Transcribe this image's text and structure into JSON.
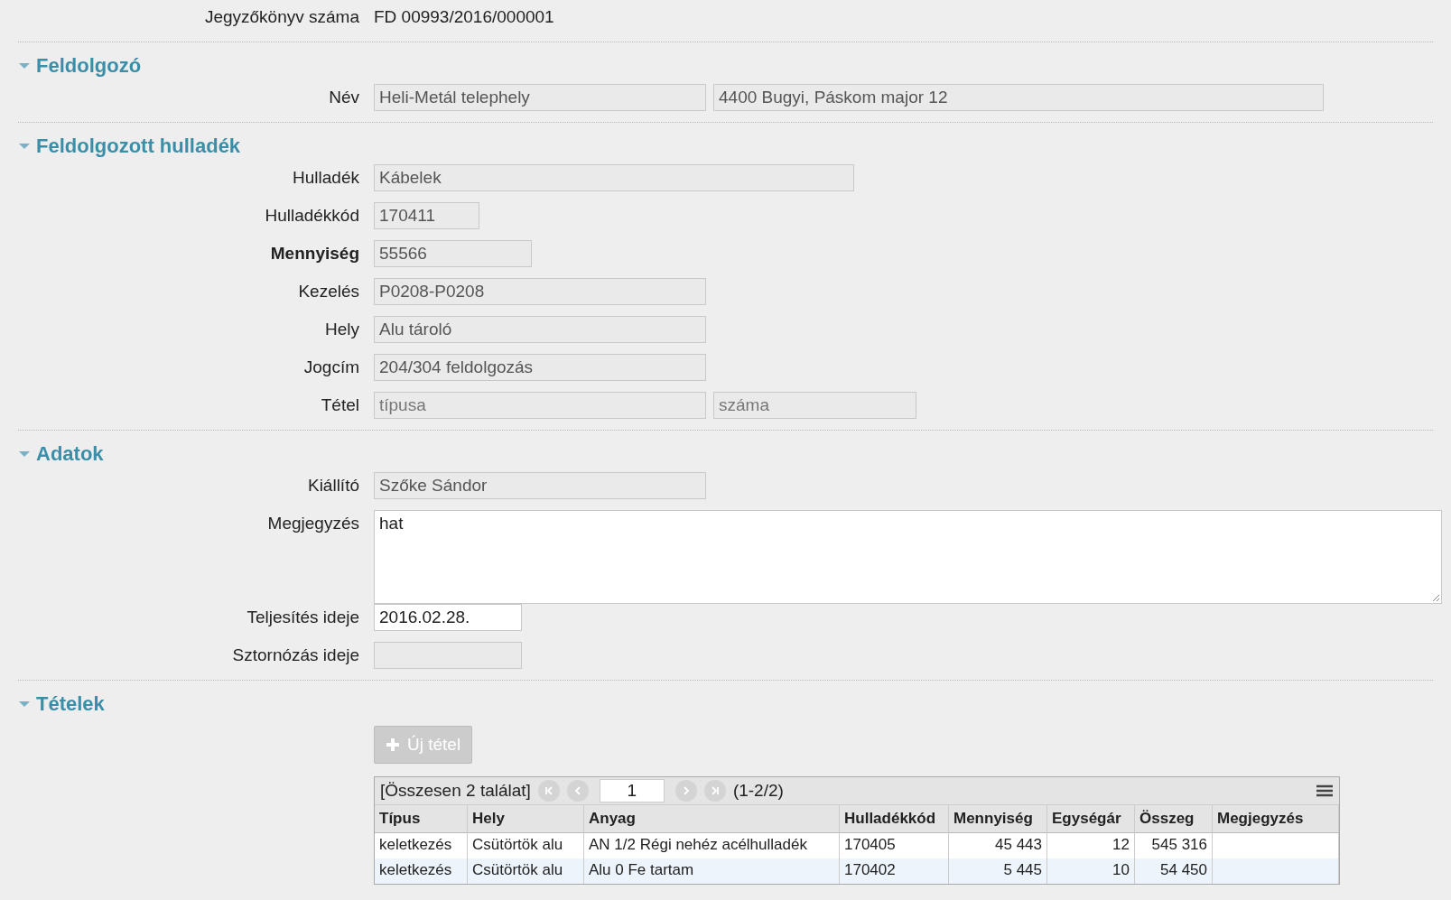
{
  "record": {
    "label": "Jegyzőkönyv száma",
    "value": "FD 00993/2016/000001"
  },
  "sections": [
    {
      "title": "Feldolgozó",
      "expanded": true,
      "rows": [
        {
          "label": "Név",
          "required": false,
          "fields": [
            {
              "kind": "medium",
              "value": "Heli-Metál telephely",
              "editable": false
            },
            {
              "kind": "wide",
              "value": "4400 Bugyi, Páskom major 12",
              "editable": false
            }
          ]
        }
      ]
    },
    {
      "title": "Feldolgozott hulladék",
      "expanded": true,
      "rows": [
        {
          "label": "Hulladék",
          "required": false,
          "fields": [
            {
              "kind": "large",
              "value": "Kábelek",
              "editable": false
            }
          ]
        },
        {
          "label": "Hulladékkód",
          "required": false,
          "fields": [
            {
              "kind": "code",
              "value": "170411",
              "editable": false
            }
          ]
        },
        {
          "label": "Mennyiség",
          "required": true,
          "fields": [
            {
              "kind": "short",
              "value": "55566",
              "editable": false
            }
          ]
        },
        {
          "label": "Kezelés",
          "required": false,
          "fields": [
            {
              "kind": "medium",
              "value": "P0208-P0208",
              "editable": false
            }
          ]
        },
        {
          "label": "Hely",
          "required": false,
          "fields": [
            {
              "kind": "medium",
              "value": "Alu tároló",
              "editable": false
            }
          ]
        },
        {
          "label": "Jogcím",
          "required": false,
          "fields": [
            {
              "kind": "medium",
              "value": "204/304 feldolgozás",
              "editable": false
            }
          ]
        },
        {
          "label": "Tétel",
          "required": false,
          "fields": [
            {
              "kind": "medium",
              "placeholder": "típusa",
              "editable": false
            },
            {
              "kind": "number",
              "placeholder": "száma",
              "editable": false
            }
          ]
        }
      ]
    },
    {
      "title": "Adatok",
      "expanded": true,
      "rows": [
        {
          "label": "Kiállító",
          "required": false,
          "fields": [
            {
              "kind": "medium",
              "value": "Szőke Sándor",
              "editable": false
            }
          ]
        },
        {
          "label": "Megjegyzés",
          "required": false,
          "fields": [
            {
              "kind": "textarea",
              "value": "hat",
              "editable": true
            }
          ]
        },
        {
          "label": "Teljesítés ideje",
          "required": false,
          "fields": [
            {
              "kind": "date",
              "value": "2016.02.28.",
              "editable": true
            }
          ]
        },
        {
          "label": "Sztornózás ideje",
          "required": false,
          "fields": [
            {
              "kind": "date",
              "editable": false
            }
          ]
        }
      ]
    }
  ],
  "items": {
    "title": "Tételek",
    "expanded": true,
    "new_button": {
      "label": "Új tétel",
      "disabled": true
    },
    "table": {
      "summary": "[Összesen 2 találat]",
      "page": "1",
      "range": "(1-2/2)",
      "pager": {
        "first_disabled": true,
        "prev_disabled": true,
        "next_disabled": true,
        "last_disabled": true
      },
      "columns": [
        {
          "label": "Típus",
          "kind": "text"
        },
        {
          "label": "Hely",
          "kind": "text"
        },
        {
          "label": "Anyag",
          "kind": "text"
        },
        {
          "label": "Hulladékkód",
          "kind": "text"
        },
        {
          "label": "Mennyiség",
          "kind": "number"
        },
        {
          "label": "Egységár",
          "kind": "number"
        },
        {
          "label": "Összeg",
          "kind": "number"
        },
        {
          "label": "Megjegyzés",
          "kind": "text"
        }
      ],
      "rows": [
        {
          "selected": false,
          "cells": [
            "keletkezés",
            "Csütörtök alu",
            "AN 1/2 Régi nehéz acélhulladék",
            "170405",
            "45 443",
            "12",
            "545 316",
            ""
          ]
        },
        {
          "selected": false,
          "cells": [
            "keletkezés",
            "Csütörtök alu",
            "Alu 0 Fe tartam",
            "170402",
            "5 445",
            "10",
            "54 450",
            ""
          ]
        }
      ]
    }
  }
}
